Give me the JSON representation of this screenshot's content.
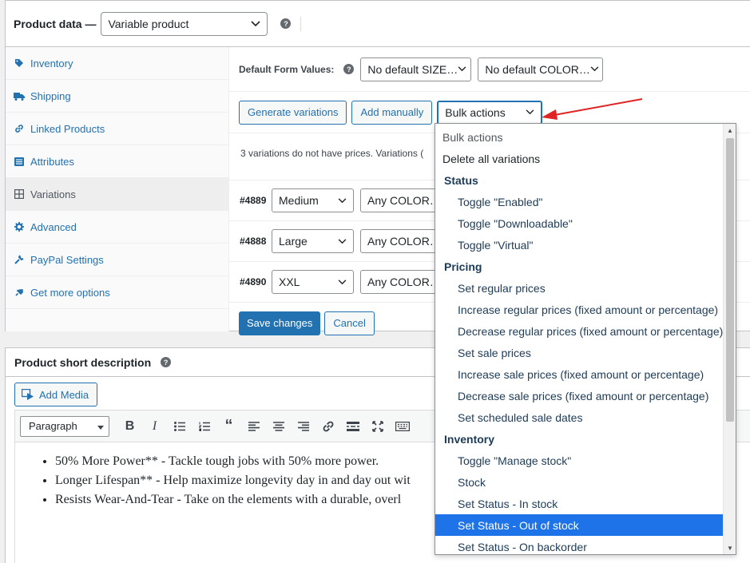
{
  "product_data": {
    "title": "Product data —",
    "product_type": "Variable product",
    "help_glyph": "?"
  },
  "tabs": [
    {
      "label": "Inventory",
      "icon": "tag-icon"
    },
    {
      "label": "Shipping",
      "icon": "truck-icon"
    },
    {
      "label": "Linked Products",
      "icon": "link-icon"
    },
    {
      "label": "Attributes",
      "icon": "list-icon"
    },
    {
      "label": "Variations",
      "icon": "grid-icon",
      "active": true
    },
    {
      "label": "Advanced",
      "icon": "gear-icon"
    },
    {
      "label": "PayPal Settings",
      "icon": "wrench-icon"
    },
    {
      "label": "Get more options",
      "icon": "plugin-icon"
    }
  ],
  "default_form": {
    "label": "Default Form Values:",
    "size_value": "No default SIZE…",
    "color_value": "No default COLOR…"
  },
  "buttons": {
    "generate": "Generate variations",
    "add_manually": "Add manually",
    "bulk_actions": "Bulk actions",
    "save": "Save changes",
    "cancel": "Cancel"
  },
  "notice_text": "3 variations do not have prices. Variations (",
  "variations": [
    {
      "id": "#4889",
      "size": "Medium",
      "color": "Any COLOR…"
    },
    {
      "id": "#4888",
      "size": "Large",
      "color": "Any COLOR…"
    },
    {
      "id": "#4890",
      "size": "XXL",
      "color": "Any COLOR…"
    }
  ],
  "short_description": {
    "title": "Product short description",
    "add_media": "Add Media",
    "format": "Paragraph",
    "bullets": [
      "50% More Power** - Tackle tough jobs with 50% more power.",
      "Longer Lifespan** - Help maximize longevity day in and day out wit",
      "Resists Wear-And-Tear - Take on the elements with a durable, overl"
    ]
  },
  "dropdown": {
    "items": [
      {
        "kind": "top",
        "label": "Bulk actions",
        "muted": true
      },
      {
        "kind": "top",
        "label": "Delete all variations"
      },
      {
        "kind": "group",
        "label": "Status"
      },
      {
        "kind": "opt",
        "label": "Toggle \"Enabled\""
      },
      {
        "kind": "opt",
        "label": "Toggle \"Downloadable\""
      },
      {
        "kind": "opt",
        "label": "Toggle \"Virtual\""
      },
      {
        "kind": "group",
        "label": "Pricing"
      },
      {
        "kind": "opt",
        "label": "Set regular prices"
      },
      {
        "kind": "opt",
        "label": "Increase regular prices (fixed amount or percentage)"
      },
      {
        "kind": "opt",
        "label": "Decrease regular prices (fixed amount or percentage)"
      },
      {
        "kind": "opt",
        "label": "Set sale prices"
      },
      {
        "kind": "opt",
        "label": "Increase sale prices (fixed amount or percentage)"
      },
      {
        "kind": "opt",
        "label": "Decrease sale prices (fixed amount or percentage)"
      },
      {
        "kind": "opt",
        "label": "Set scheduled sale dates"
      },
      {
        "kind": "group",
        "label": "Inventory"
      },
      {
        "kind": "opt",
        "label": "Toggle \"Manage stock\""
      },
      {
        "kind": "opt",
        "label": "Stock"
      },
      {
        "kind": "opt",
        "label": "Set Status - In stock"
      },
      {
        "kind": "opt",
        "label": "Set Status - Out of stock",
        "selected": true
      },
      {
        "kind": "opt",
        "label": "Set Status - On backorder"
      }
    ]
  },
  "colors": {
    "accent": "#2271b1",
    "selected": "#1e73e8",
    "arrow": "#e02424"
  }
}
